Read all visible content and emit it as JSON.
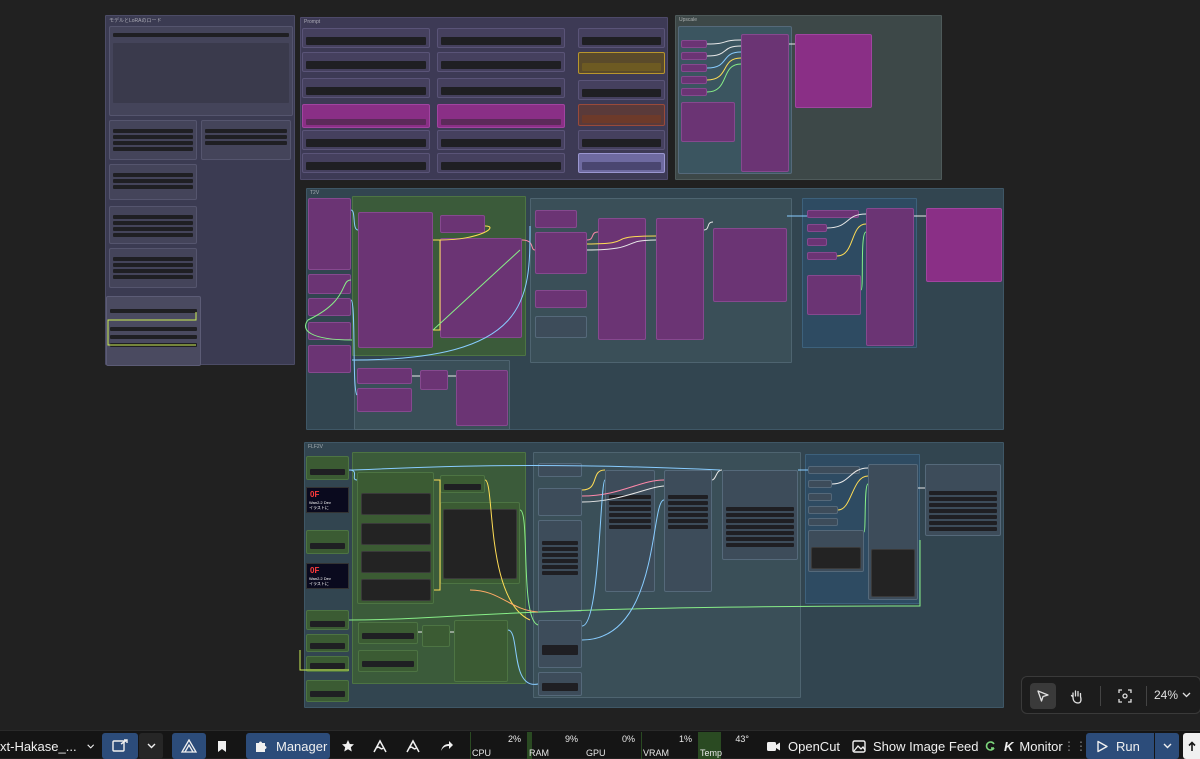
{
  "workflow": {
    "name_truncated": "xt-Hakase_...",
    "groups": [
      {
        "id": "g-model-loader",
        "title": "モデルとLoRAのロード"
      },
      {
        "id": "g-prompt",
        "title": "Prompt"
      },
      {
        "id": "g-upscale",
        "title": "Upscale"
      },
      {
        "id": "g-t2v",
        "title": "T2V"
      },
      {
        "id": "g-i2v",
        "title": "FLF2V"
      }
    ],
    "thumbnails": [
      {
        "big": "0F",
        "line1": "Wan2.2 Dev",
        "line2": "イラストに"
      },
      {
        "big": "0F",
        "line1": "Wan2.2 Dev",
        "line2": "イラストに"
      }
    ]
  },
  "canvas_controls": {
    "zoom": "24%",
    "select_icon": "pointer-icon",
    "hand_icon": "hand-icon",
    "fit_icon": "fit-view-icon"
  },
  "toolbar": {
    "manager_label": "Manager",
    "stats": [
      {
        "label": "CPU",
        "value": "2%",
        "fill": 0.02
      },
      {
        "label": "RAM",
        "value": "9%",
        "fill": 0.09
      },
      {
        "label": "GPU",
        "value": "0%",
        "fill": 0.0
      },
      {
        "label": "VRAM",
        "value": "1%",
        "fill": 0.01
      },
      {
        "label": "Temp",
        "value": "43°",
        "fill": 0.43
      }
    ],
    "opencut_label": "OpenCut",
    "image_feed_label": "Show Image Feed",
    "monitor_label": "Monitor",
    "run_label": "Run",
    "colors": {
      "accent": "#2c4c7a",
      "bar_fill": "#2a4a22"
    }
  }
}
